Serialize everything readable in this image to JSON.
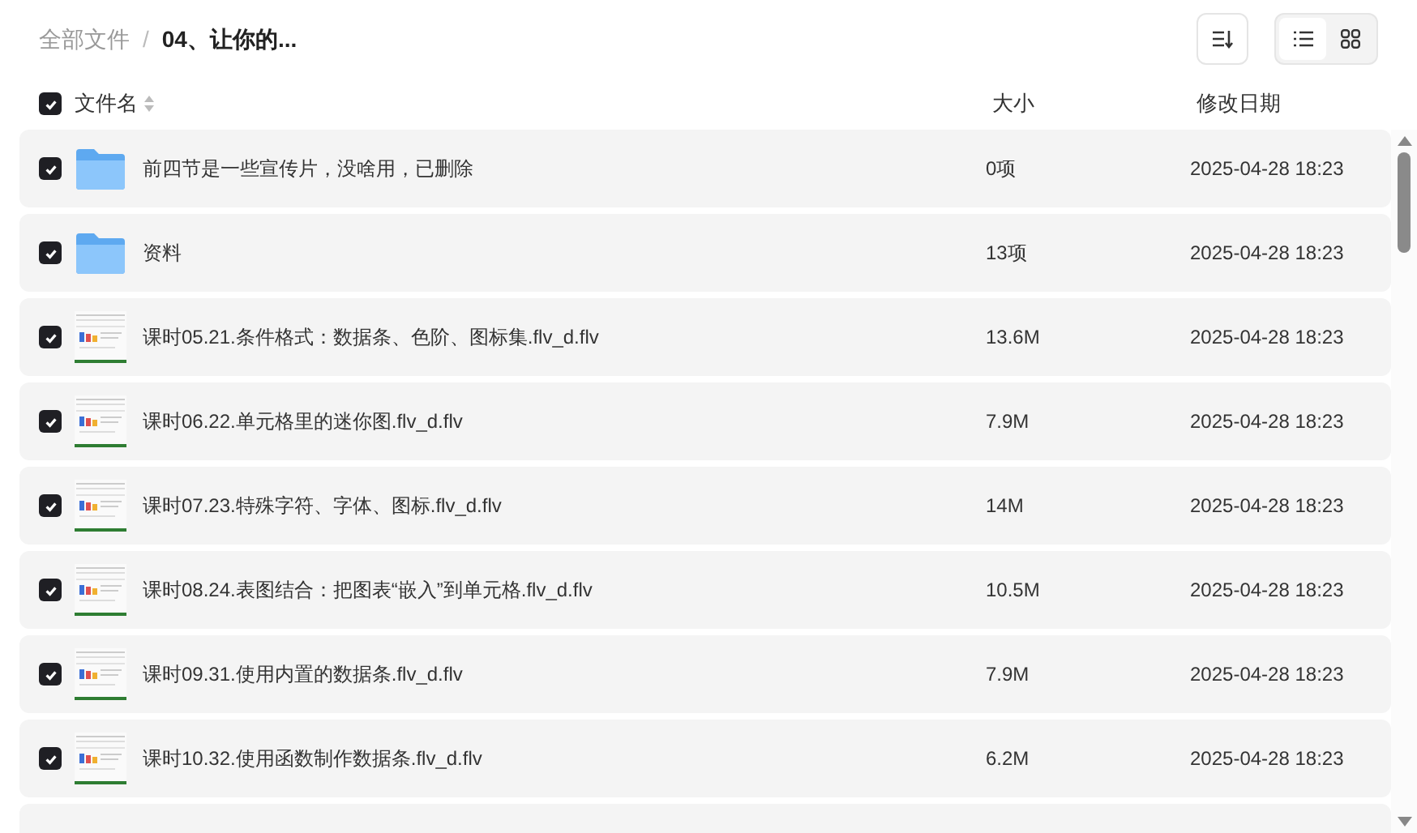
{
  "breadcrumb": {
    "root": "全部文件",
    "separator": "/",
    "current": "04、让你的..."
  },
  "toolbar": {
    "view_buttons": [
      {
        "kind": "list",
        "selected": true
      },
      {
        "kind": "grid",
        "selected": false
      }
    ]
  },
  "columns": {
    "select_all": {
      "checked": true
    },
    "name": "文件名",
    "size": "大小",
    "modified": "修改日期"
  },
  "rows": [
    {
      "kind": "folder",
      "checked": true,
      "name": "前四节是一些宣传片，没啥用，已删除",
      "size": "0项",
      "modified": "2025-04-28 18:23"
    },
    {
      "kind": "folder",
      "checked": true,
      "name": "资料",
      "size": "13项",
      "modified": "2025-04-28 18:23"
    },
    {
      "kind": "video",
      "checked": true,
      "name": "课时05.21.条件格式：数据条、色阶、图标集.flv_d.flv",
      "size": "13.6M",
      "modified": "2025-04-28 18:23"
    },
    {
      "kind": "video",
      "checked": true,
      "name": "课时06.22.单元格里的迷你图.flv_d.flv",
      "size": "7.9M",
      "modified": "2025-04-28 18:23"
    },
    {
      "kind": "video",
      "checked": true,
      "name": "课时07.23.特殊字符、字体、图标.flv_d.flv",
      "size": "14M",
      "modified": "2025-04-28 18:23"
    },
    {
      "kind": "video",
      "checked": true,
      "name": "课时08.24.表图结合：把图表“嵌入”到单元格.flv_d.flv",
      "size": "10.5M",
      "modified": "2025-04-28 18:23"
    },
    {
      "kind": "video",
      "checked": true,
      "name": "课时09.31.使用内置的数据条.flv_d.flv",
      "size": "7.9M",
      "modified": "2025-04-28 18:23"
    },
    {
      "kind": "video",
      "checked": true,
      "name": "课时10.32.使用函数制作数据条.flv_d.flv",
      "size": "6.2M",
      "modified": "2025-04-28 18:23"
    }
  ]
}
